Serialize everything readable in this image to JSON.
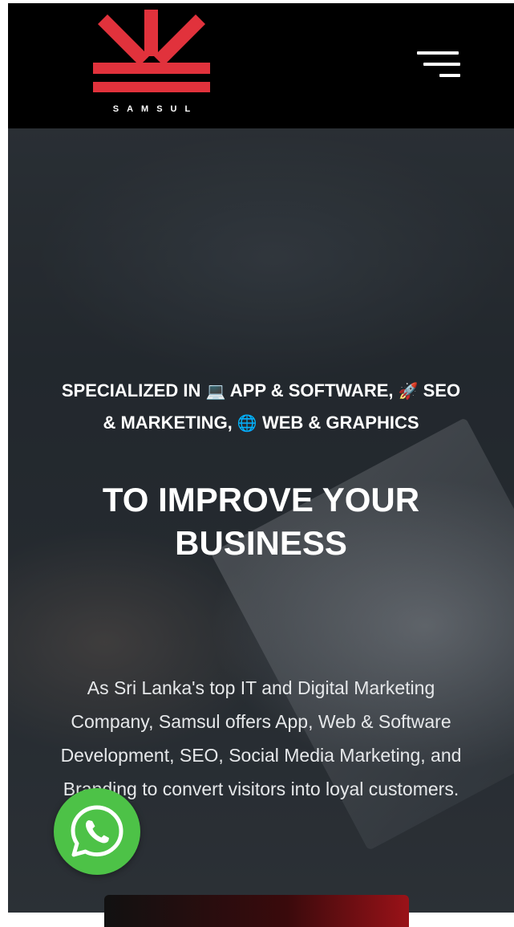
{
  "brand": {
    "name": "SAMSUL",
    "logo_color": "#e1323c"
  },
  "header": {
    "menu_icon": "hamburger-menu-icon"
  },
  "hero": {
    "tagline_part1": "SPECIALIZED IN",
    "tagline_emoji1": "💻",
    "tagline_part2": "APP & SOFTWARE,",
    "tagline_emoji2": "🚀",
    "tagline_part3": "SEO",
    "tagline_part4": "& MARKETING,",
    "tagline_emoji3": "🌐",
    "tagline_part5": "WEB & GRAPHICS",
    "headline_line1": "TO IMPROVE YOUR",
    "headline_line2": "BUSINESS",
    "description_line1": "As Sri Lanka's top IT and Digital Marketing",
    "description_line2": "Company, Samsul offers App, Web & Software",
    "description_line3": "Development, SEO, Social Media Marketing, and",
    "description_line4": "Branding to convert visitors into loyal customers."
  },
  "floating": {
    "whatsapp_icon": "whatsapp-icon",
    "whatsapp_color": "#4dc247"
  }
}
